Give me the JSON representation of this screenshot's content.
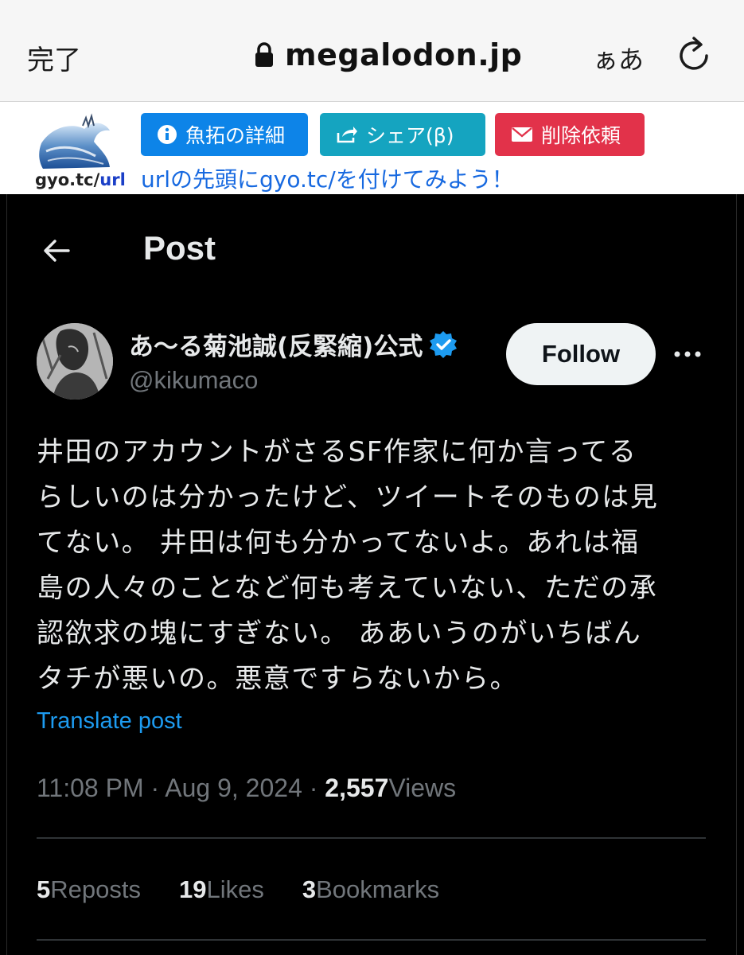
{
  "browser": {
    "done_label": "完了",
    "url": "megalodon.jp",
    "text_size_label": "ぁあ"
  },
  "banner": {
    "logo_text_domain": "gyo.tc/",
    "logo_text_url": "url",
    "info_button": "魚拓の詳細",
    "share_button": "シェア(β)",
    "delete_button": "削除依頼",
    "hint": "urlの先頭にgyo.tc/を付けてみよう！"
  },
  "post": {
    "header_title": "Post",
    "author": {
      "display_name": "あ〜る菊池誠(反緊縮)公式",
      "handle": "@kikumaco",
      "verified": true
    },
    "follow_label": "Follow",
    "text_lines": [
      "井田のアカウントがさるSF作家に何か言ってる",
      "らしいのは分かったけど、ツイートそのものは見",
      "てない。 井田は何も分かってないよ。あれは福",
      "島の人々のことなど何も考えていない、ただの承",
      "認欲求の塊にすぎない。 ああいうのがいちばん",
      "タチが悪いの。悪意ですらないから。"
    ],
    "translate_label": "Translate post",
    "time": "11:08 PM",
    "date": "Aug 9, 2024",
    "views_count": "2,557",
    "views_label": "Views",
    "stats": {
      "reposts_count": "5",
      "reposts_label": "Reposts",
      "likes_count": "19",
      "likes_label": "Likes",
      "bookmarks_count": "3",
      "bookmarks_label": "Bookmarks"
    }
  },
  "colors": {
    "background": "#000000",
    "text_primary": "#e7e9ea",
    "text_secondary": "#71767b",
    "link_blue": "#1d9bf0",
    "verified_blue": "#1d9bf0",
    "info_button": "#0d84e8",
    "share_button": "#15a4c0",
    "delete_button": "#e2324a"
  }
}
